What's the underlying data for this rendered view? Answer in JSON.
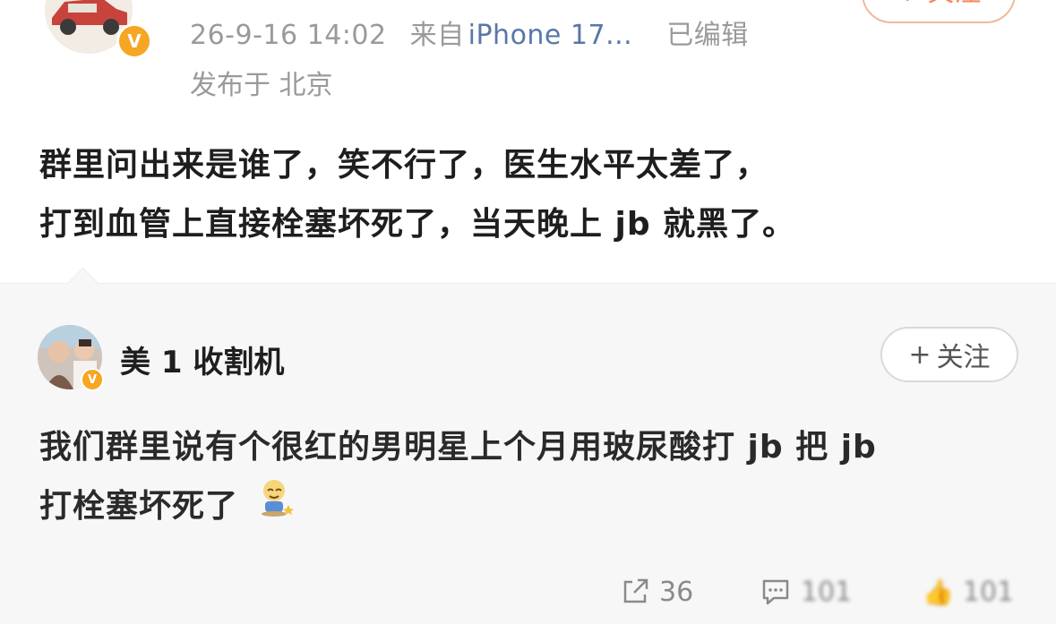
{
  "post": {
    "timestamp": "26-9-16 14:02",
    "source_prefix": "来自",
    "source": "iPhone 17...",
    "edited": "已编辑",
    "location": "发布于 北京",
    "follow_label": "+ 关注",
    "text_line1": "群里问出来是谁了，笑不行了，医生水平太差了，",
    "text_line2": "打到血管上直接栓塞坏死了，当天晚上 jb 就黑了。",
    "verified_badge_icon": "verified-v-icon"
  },
  "comment": {
    "user_name": "美 1 收割机",
    "follow_label": "关注",
    "follow_plus": "+",
    "text_line1": "我们群里说有个很红的男明星上个月用玻尿酸打 jb 把 jb",
    "text_line2": "打栓塞坏死了",
    "emoji_icon": "sit-emoji-icon"
  },
  "actions": {
    "share_count": "36",
    "comment_count": "101",
    "like_count": "101"
  },
  "colors": {
    "accent_orange": "#f08a5d",
    "badge_orange": "#f6a623",
    "link_blue": "#5877a8",
    "meta_gray": "#9a9a9a"
  }
}
